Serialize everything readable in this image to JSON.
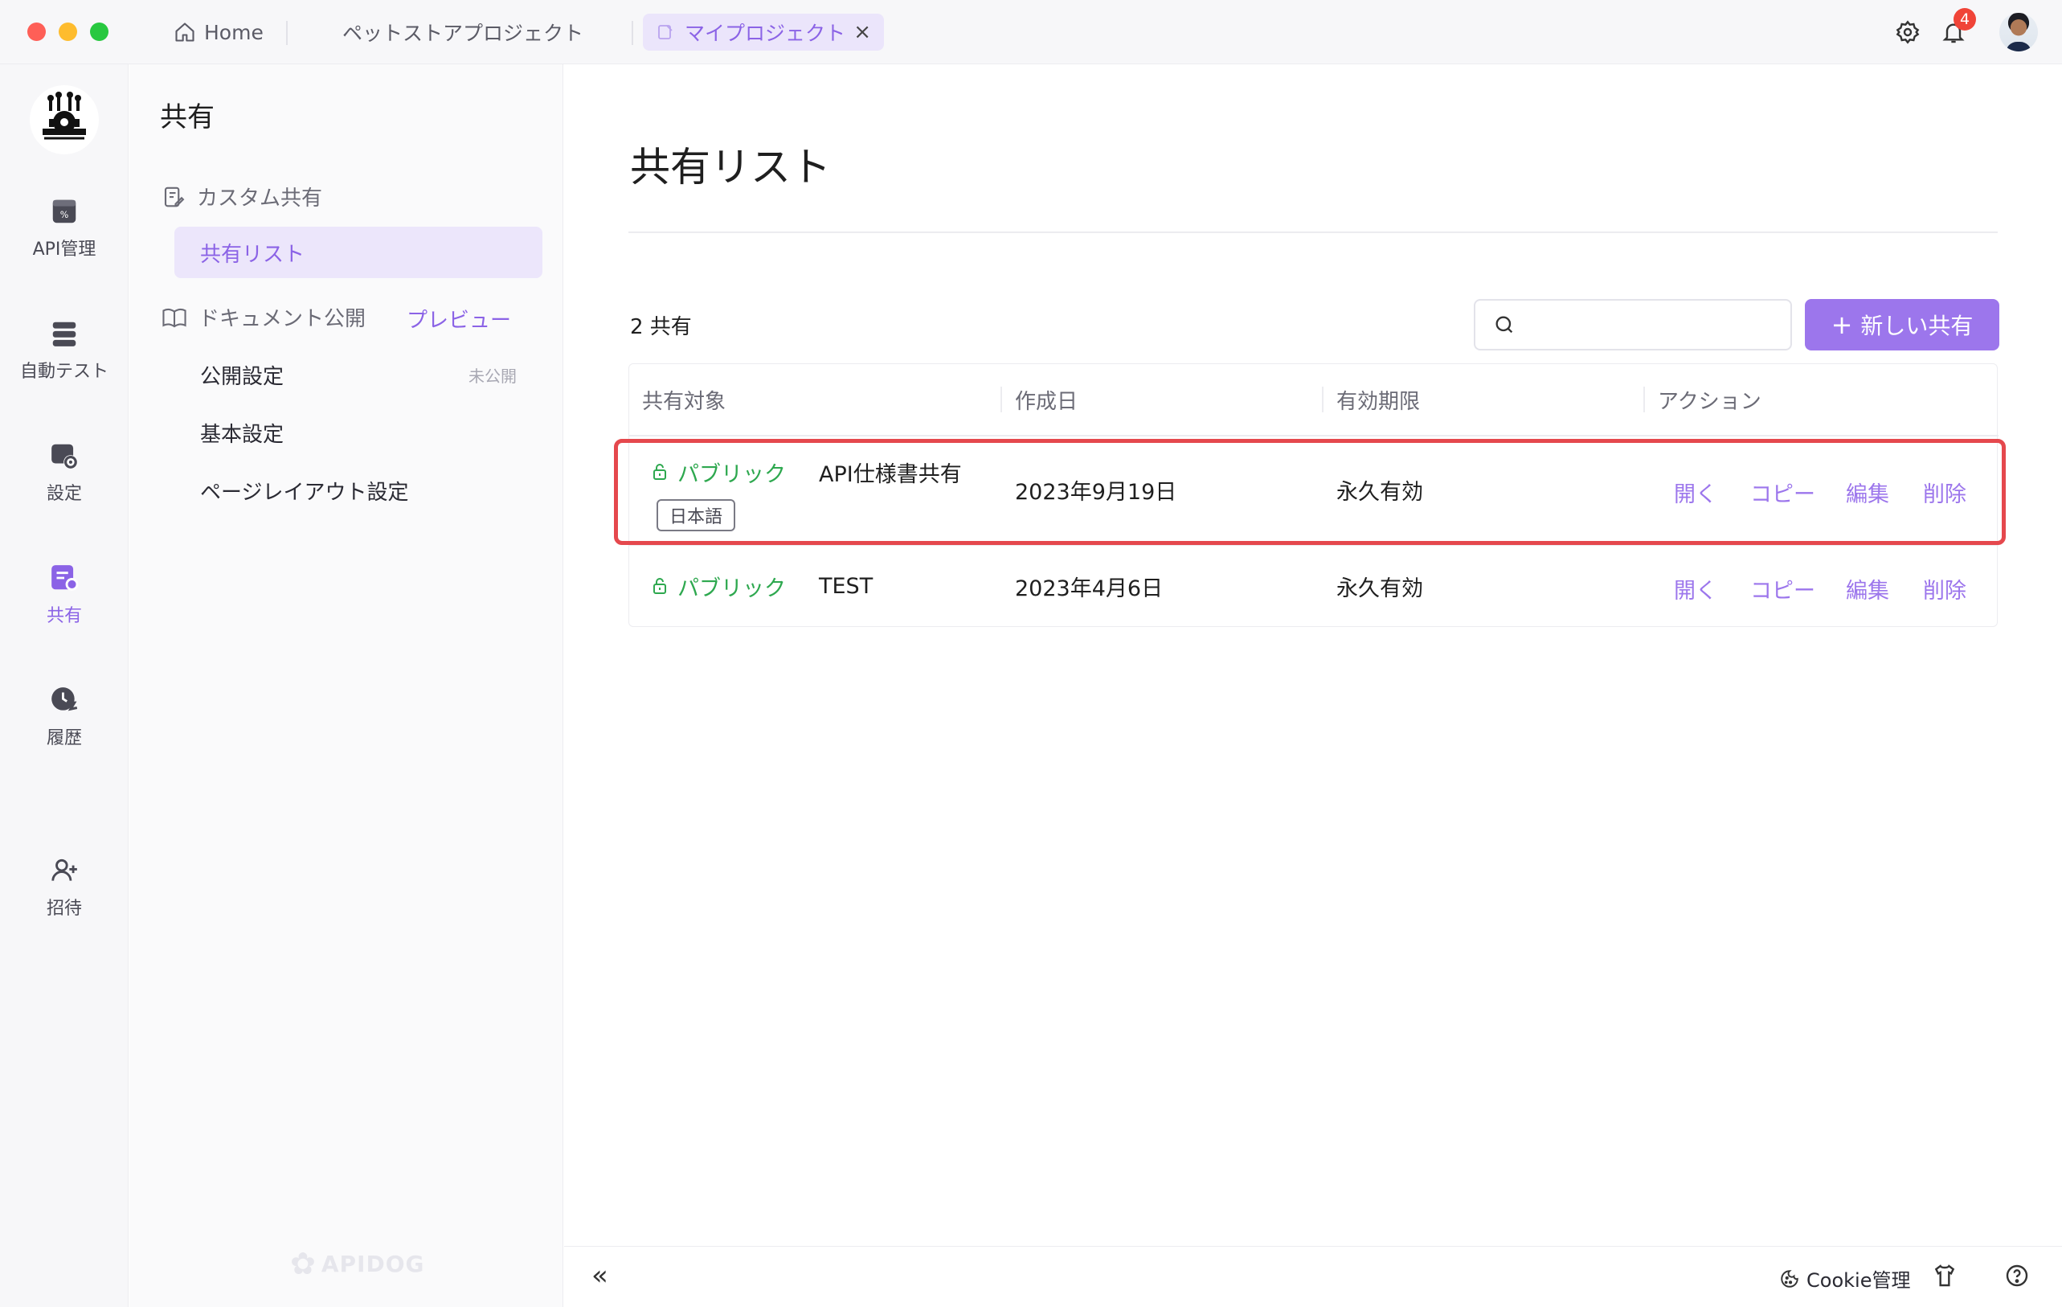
{
  "titlebar": {
    "tabs": [
      {
        "label": "Home",
        "icon": "home-icon"
      },
      {
        "label": "ペットストアプロジェクト"
      },
      {
        "label": "マイプロジェクト",
        "icon": "document-icon",
        "active": true
      }
    ],
    "notifications": "4"
  },
  "rail": {
    "items": [
      {
        "label": "API管理",
        "icon": "api-icon"
      },
      {
        "label": "自動テスト",
        "icon": "auto-test-icon"
      },
      {
        "label": "設定",
        "icon": "settings-icon"
      },
      {
        "label": "共有",
        "icon": "share-icon",
        "active": true
      },
      {
        "label": "履歴",
        "icon": "history-icon"
      },
      {
        "label": "招待",
        "icon": "invite-icon"
      }
    ]
  },
  "sidebar": {
    "title": "共有",
    "custom_share": "カスタム共有",
    "share_list": "共有リスト",
    "doc_publish": "ドキュメント公開",
    "preview": "プレビュー",
    "publish_settings": "公開設定",
    "unpublished": "未公開",
    "basic_settings": "基本設定",
    "page_layout": "ページレイアウト設定",
    "watermark": "APIDOG"
  },
  "main": {
    "title": "共有リスト",
    "count": "2 共有",
    "search_placeholder": "",
    "new_button": "新しい共有",
    "columns": [
      "共有対象",
      "作成日",
      "有効期限",
      "アクション"
    ],
    "rows": [
      {
        "visibility": "パブリック",
        "name": "API仕様書共有",
        "lang": "日本語",
        "created": "2023年9月19日",
        "expires": "永久有効",
        "actions": [
          "開く",
          "コピー",
          "編集",
          "削除"
        ]
      },
      {
        "visibility": "パブリック",
        "name": "TEST",
        "created": "2023年4月6日",
        "expires": "永久有効",
        "actions": [
          "開く",
          "コピー",
          "編集",
          "削除"
        ]
      }
    ]
  },
  "bottombar": {
    "cookie": "Cookie管理"
  },
  "colors": {
    "accent": "#9c76ec",
    "public": "#2ea84f",
    "highlight": "#e5484d",
    "badge": "#f04438"
  }
}
